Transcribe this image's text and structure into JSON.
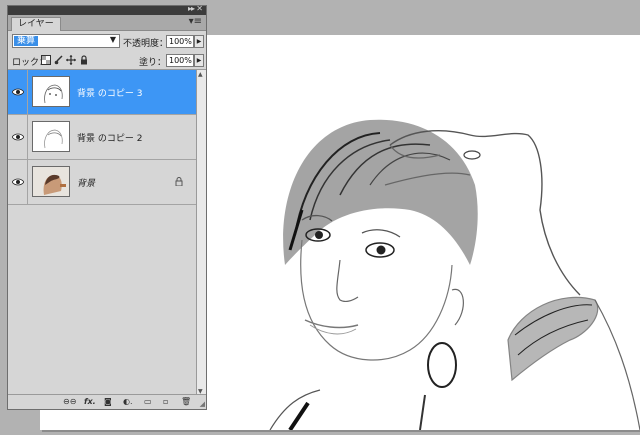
{
  "panel": {
    "tab_label": "レイヤー",
    "collapse_icon": "double-chevron-right-icon",
    "close_icon": "close-icon",
    "menu_icon": "panel-menu-icon",
    "blend_mode": "乗算",
    "opacity_label": "不透明度：",
    "opacity_value": "100%",
    "lock_label": "ロック：",
    "fill_label": "塗り：",
    "fill_value": "100%",
    "accent_color": "#3d96f5"
  },
  "layers": [
    {
      "name": "背景 のコピー 3",
      "selected": true,
      "visible": true
    },
    {
      "name": "背景 のコピー 2",
      "selected": false,
      "visible": true
    },
    {
      "name": "背景",
      "selected": false,
      "visible": true,
      "locked": true
    }
  ],
  "bottom_icons": [
    "link-layers-icon",
    "fx-icon",
    "layer-mask-icon",
    "adjustment-layer-icon",
    "new-group-icon",
    "new-layer-icon",
    "trash-icon"
  ],
  "bottom_labels": {
    "fx": "fx."
  }
}
